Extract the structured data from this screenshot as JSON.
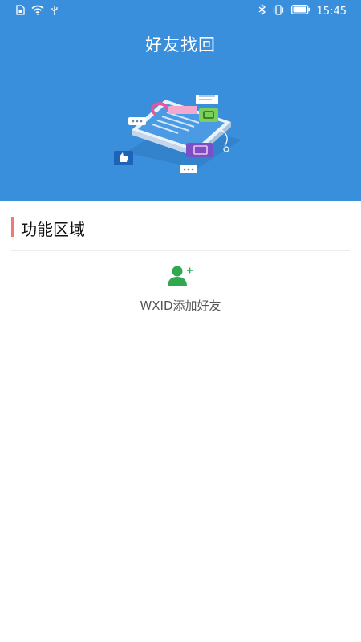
{
  "status_bar": {
    "time": "15:45",
    "icons": [
      "sim-card-icon",
      "wifi-icon",
      "usb-icon",
      "bluetooth-icon",
      "vibrate-icon",
      "battery-icon"
    ]
  },
  "header": {
    "title": "好友找回"
  },
  "section": {
    "title": "功能区域"
  },
  "functions": [
    {
      "label": "WXID添加好友",
      "icon": "add-user-icon"
    }
  ],
  "colors": {
    "header_bg": "#3a8fdc",
    "accent_bar": "#f07a7a",
    "icon_green": "#2fa84f"
  }
}
